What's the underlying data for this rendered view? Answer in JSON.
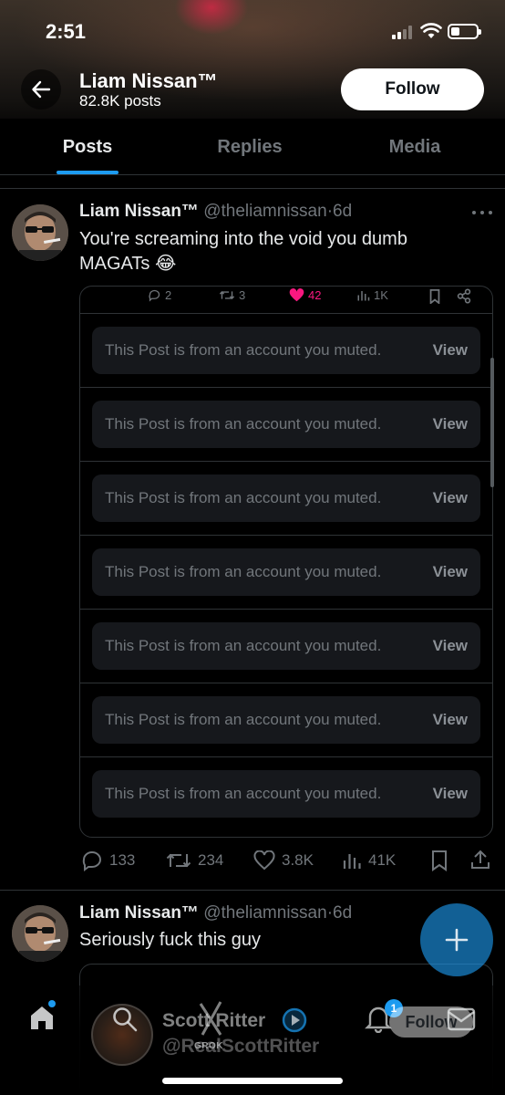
{
  "status_bar": {
    "time": "2:51",
    "battery_level": 0.35
  },
  "header": {
    "name": "Liam Nissan™",
    "posts_count": "82.8K posts",
    "follow_label": "Follow",
    "back_icon": "arrow-left-icon"
  },
  "tabs": [
    {
      "label": "Posts",
      "active": true
    },
    {
      "label": "Replies",
      "active": false
    },
    {
      "label": "Media",
      "active": false
    }
  ],
  "post1": {
    "author_name": "Liam Nissan™",
    "author_handle": "@theliamnissan",
    "separator": "·",
    "time": "6d",
    "text_line1": "You're screaming into the void you dumb",
    "text_line2": "MAGATs 😂",
    "quote_actions": {
      "replies": "2",
      "reposts": "3",
      "likes": "42",
      "views": "1K"
    },
    "muted_rows": [
      {
        "text": "This Post is from an account you muted.",
        "view": "View"
      },
      {
        "text": "This Post is from an account you muted.",
        "view": "View"
      },
      {
        "text": "This Post is from an account you muted.",
        "view": "View"
      },
      {
        "text": "This Post is from an account you muted.",
        "view": "View"
      },
      {
        "text": "This Post is from an account you muted.",
        "view": "View"
      },
      {
        "text": "This Post is from an account you muted.",
        "view": "View"
      },
      {
        "text": "This Post is from an account you muted.",
        "view": "View"
      }
    ],
    "actions": {
      "replies": "133",
      "reposts": "234",
      "likes": "3.8K",
      "views": "41K"
    }
  },
  "post2": {
    "author_name": "Liam Nissan™",
    "author_handle": "@theliamnissan",
    "separator": "·",
    "time": "6d",
    "text": "Seriously fuck this guy"
  },
  "overlay_preview": {
    "name": "Scott Ritter",
    "handle": "@RealScottRitter",
    "follow_label": "Follow",
    "grok_label": "GROK",
    "notification_count": "1"
  },
  "colors": {
    "accent": "#1d9bf0",
    "like": "#f91880",
    "background": "#000000",
    "secondary_text": "#71767b"
  }
}
